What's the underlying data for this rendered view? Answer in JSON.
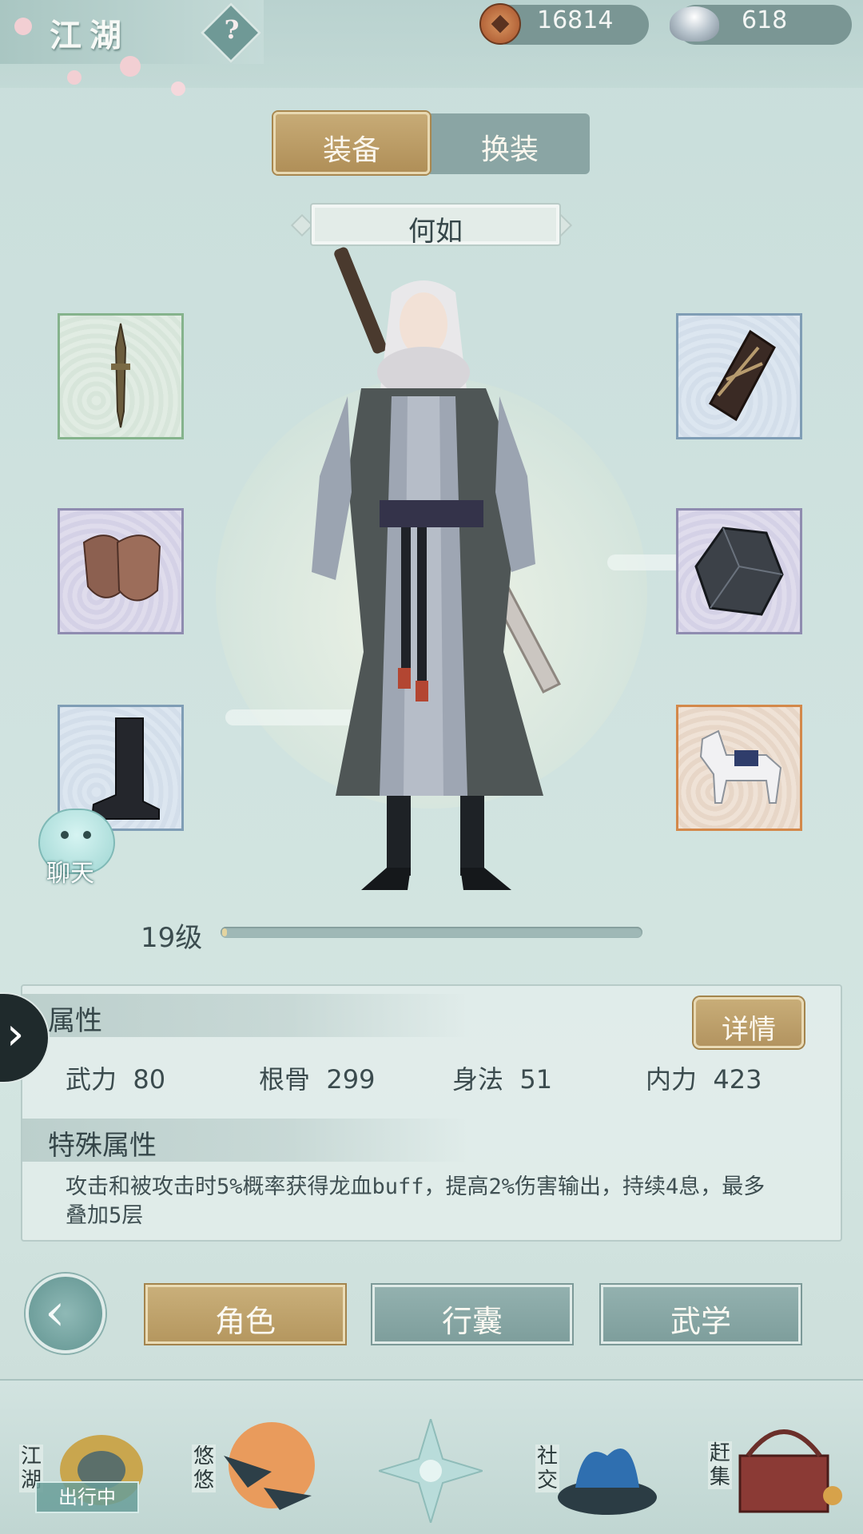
{
  "header": {
    "title": "江湖",
    "help_label": "?",
    "currency": {
      "copper": "16814",
      "silver": "618"
    }
  },
  "tabs": [
    {
      "label": "装备",
      "active": true
    },
    {
      "label": "换装",
      "active": false
    }
  ],
  "character": {
    "name": "何如",
    "level_label": "19级",
    "level_progress": 0.01
  },
  "equipment": {
    "left": [
      "sword",
      "gloves",
      "boots"
    ],
    "right": [
      "bracer",
      "gem",
      "horse"
    ]
  },
  "chat": {
    "label": "聊天"
  },
  "attributes": {
    "title": "属性",
    "detail_button": "详情",
    "stats": [
      {
        "name": "武力",
        "value": "80"
      },
      {
        "name": "根骨",
        "value": "299"
      },
      {
        "name": "身法",
        "value": "51"
      },
      {
        "name": "内力",
        "value": "423"
      }
    ],
    "special_title": "特殊属性",
    "special_desc": "攻击和被攻击时5%概率获得龙血buff，提高2%伤害输出，持续4息，最多叠加5层"
  },
  "actions": [
    "角色",
    "行囊",
    "武学"
  ],
  "bottom_nav": [
    {
      "label": "江湖",
      "badge": "出行中"
    },
    {
      "label": "悠悠"
    },
    {
      "label": ""
    },
    {
      "label": "社交"
    },
    {
      "label": "赶集"
    }
  ],
  "colors": {
    "gold": "#b5975f",
    "teal": "#7e9e9c",
    "background": "#cfe2df"
  }
}
